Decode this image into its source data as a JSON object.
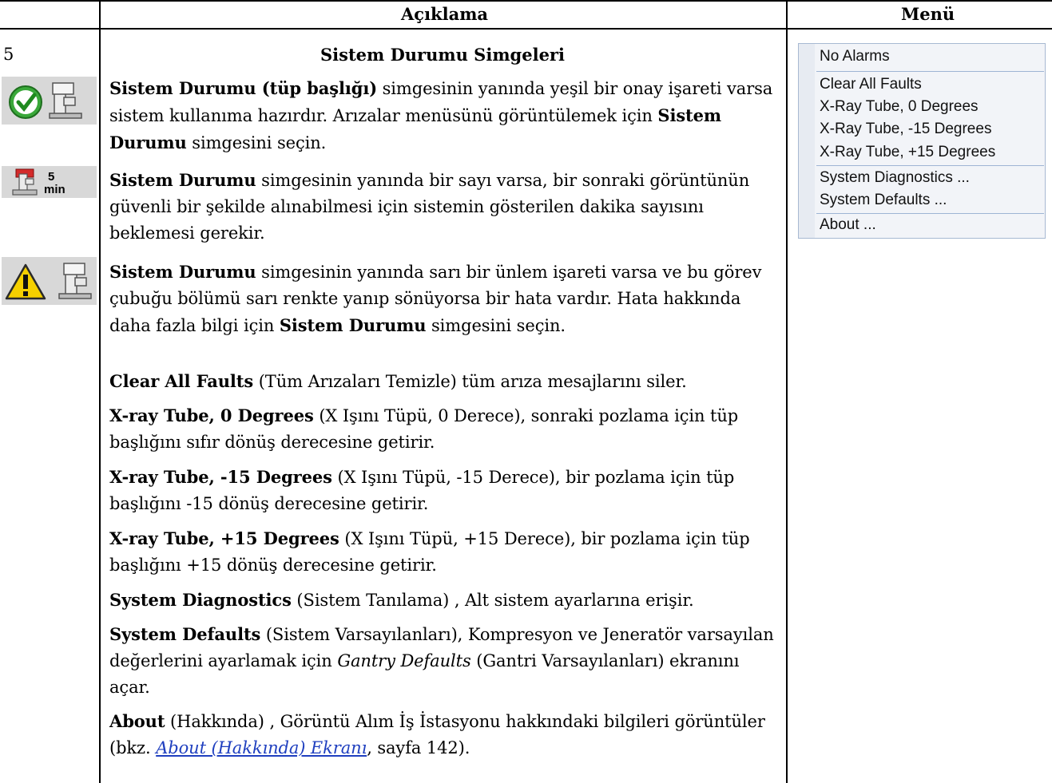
{
  "header": {
    "description_col": "Açıklama",
    "menu_col": "Menü"
  },
  "row": {
    "number": "5",
    "title": "Sistem Durumu Simgeleri"
  },
  "icons": {
    "ready": "system-status-ready-icon",
    "wait": "system-status-wait-icon",
    "wait_number": "5",
    "wait_unit": "min",
    "fault": "system-status-fault-icon"
  },
  "paragraphs": {
    "p1_bold": "Sistem Durumu (tüp başlığı)",
    "p1_rest": " simgesinin yanında yeşil bir onay işareti varsa sistem kullanıma hazırdır. Arızalar menüsünü görüntülemek için ",
    "p1_bold2": "Sistem Durumu",
    "p1_end": " simgesini seçin.",
    "p2_bold": "Sistem Durumu",
    "p2_rest": " simgesinin yanında bir sayı varsa, bir sonraki görüntünün güvenli bir şekilde alınabilmesi için sistemin gösterilen dakika sayısını beklemesi gerekir.",
    "p3_bold": "Sistem Durumu",
    "p3_rest": " simgesinin yanında sarı bir ünlem işareti varsa ve bu görev çubuğu bölümü sarı renkte yanıp sönüyorsa bir hata vardır. Hata hakkında daha fazla bilgi için ",
    "p3_bold2": "Sistem Durumu",
    "p3_end": " simgesini seçin.",
    "p4_bold": "Clear All Faults",
    "p4_rest": " (Tüm Arızaları Temizle) tüm arıza mesajlarını siler.",
    "p5_bold": "X-ray Tube, 0 Degrees",
    "p5_rest": " (X Işını Tüpü, 0 Derece), sonraki pozlama için tüp başlığını sıfır dönüş derecesine getirir.",
    "p6_bold": "X-ray Tube, -15 Degrees",
    "p6_rest": " (X Işını Tüpü, -15 Derece), bir pozlama için tüp başlığını -15 dönüş derecesine getirir.",
    "p7_bold": "X-ray Tube, +15 Degrees",
    "p7_rest": " (X Işını Tüpü, +15 Derece), bir pozlama için tüp başlığını +15 dönüş derecesine getirir.",
    "p8_bold": "System Diagnostics",
    "p8_rest": " (Sistem Tanılama) , Alt sistem ayarlarına erişir.",
    "p9_bold": "System Defaults",
    "p9_rest": " (Sistem Varsayılanları), Kompresyon ve Jeneratör varsayılan değerlerini ayarlamak için ",
    "p9_italic": "Gantry Defaults",
    "p9_end": " (Gantri Varsayılanları) ekranını açar.",
    "p10_bold": "About",
    "p10_rest": " (Hakkında) , Görüntü Alım İş İstasyonu hakkındaki bilgileri görüntüler (bkz. ",
    "p10_link": "About (Hakkında) Ekranı",
    "p10_end": ", sayfa 142)."
  },
  "menu": {
    "items": [
      "No Alarms",
      "Clear All Faults",
      "X-Ray Tube, 0 Degrees",
      "X-Ray Tube, -15 Degrees",
      "X-Ray Tube, +15 Degrees",
      "System Diagnostics ...",
      "System Defaults ...",
      "About ..."
    ]
  },
  "colors": {
    "link": "#1f3fbf",
    "check_green": "#2e9a2e",
    "alert_red": "#d42a2a",
    "warning_yellow": "#f5d000",
    "menu_border": "#a7b9d2"
  }
}
